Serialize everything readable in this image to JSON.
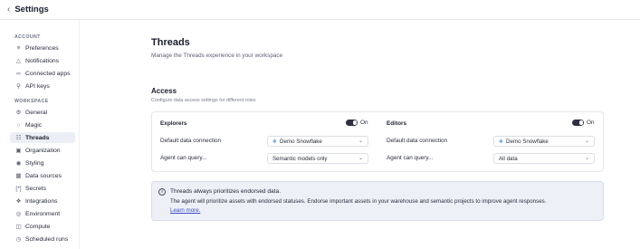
{
  "topbar": {
    "back_icon": "chevron-left-icon",
    "title": "Settings"
  },
  "sidebar": {
    "account_label": "ACCOUNT",
    "account_items": [
      {
        "label": "Preferences",
        "icon": "sliders-icon"
      },
      {
        "label": "Notifications",
        "icon": "bell-icon"
      },
      {
        "label": "Connected apps",
        "icon": "link-icon"
      },
      {
        "label": "API keys",
        "icon": "key-icon"
      }
    ],
    "workspace_label": "WORKSPACE",
    "workspace_items": [
      {
        "label": "General",
        "icon": "gear-icon"
      },
      {
        "label": "Magic",
        "icon": "magic-icon"
      },
      {
        "label": "Threads",
        "icon": "threads-icon",
        "active": true
      },
      {
        "label": "Organization",
        "icon": "organization-icon"
      },
      {
        "label": "Styling",
        "icon": "palette-icon"
      },
      {
        "label": "Data sources",
        "icon": "database-icon"
      },
      {
        "label": "Secrets",
        "icon": "secrets-icon"
      },
      {
        "label": "Integrations",
        "icon": "integrations-icon"
      },
      {
        "label": "Environment",
        "icon": "globe-icon"
      },
      {
        "label": "Compute",
        "icon": "compute-icon"
      },
      {
        "label": "Scheduled runs",
        "icon": "clock-icon"
      }
    ]
  },
  "main": {
    "title": "Threads",
    "subtitle": "Manage the Threads experience in your workspace",
    "access": {
      "title": "Access",
      "subtitle": "Configure data access settings for different roles",
      "roles": [
        {
          "name": "Explorers",
          "toggle_label": "On",
          "toggle_on": true,
          "default_connection_label": "Default data connection",
          "default_connection_value": "Demo Snowflake",
          "agent_query_label": "Agent can query...",
          "agent_query_value": "Semantic models only"
        },
        {
          "name": "Editors",
          "toggle_label": "On",
          "toggle_on": true,
          "default_connection_label": "Default data connection",
          "default_connection_value": "Demo Snowflake",
          "agent_query_label": "Agent can query...",
          "agent_query_value": "All data"
        }
      ]
    },
    "callout": {
      "title": "Threads always prioritizes endorsed data.",
      "body": "The agent will prioritize assets with endorsed statuses. Endorse important assets in your warehouse and semantic projects to improve agent responses.",
      "link": "Learn more."
    }
  },
  "colors": {
    "accent": "#3b4cc0",
    "toggle_on": "#2c3040",
    "snowflake": "#2a7ccf",
    "callout_bg": "#eef0f7"
  }
}
